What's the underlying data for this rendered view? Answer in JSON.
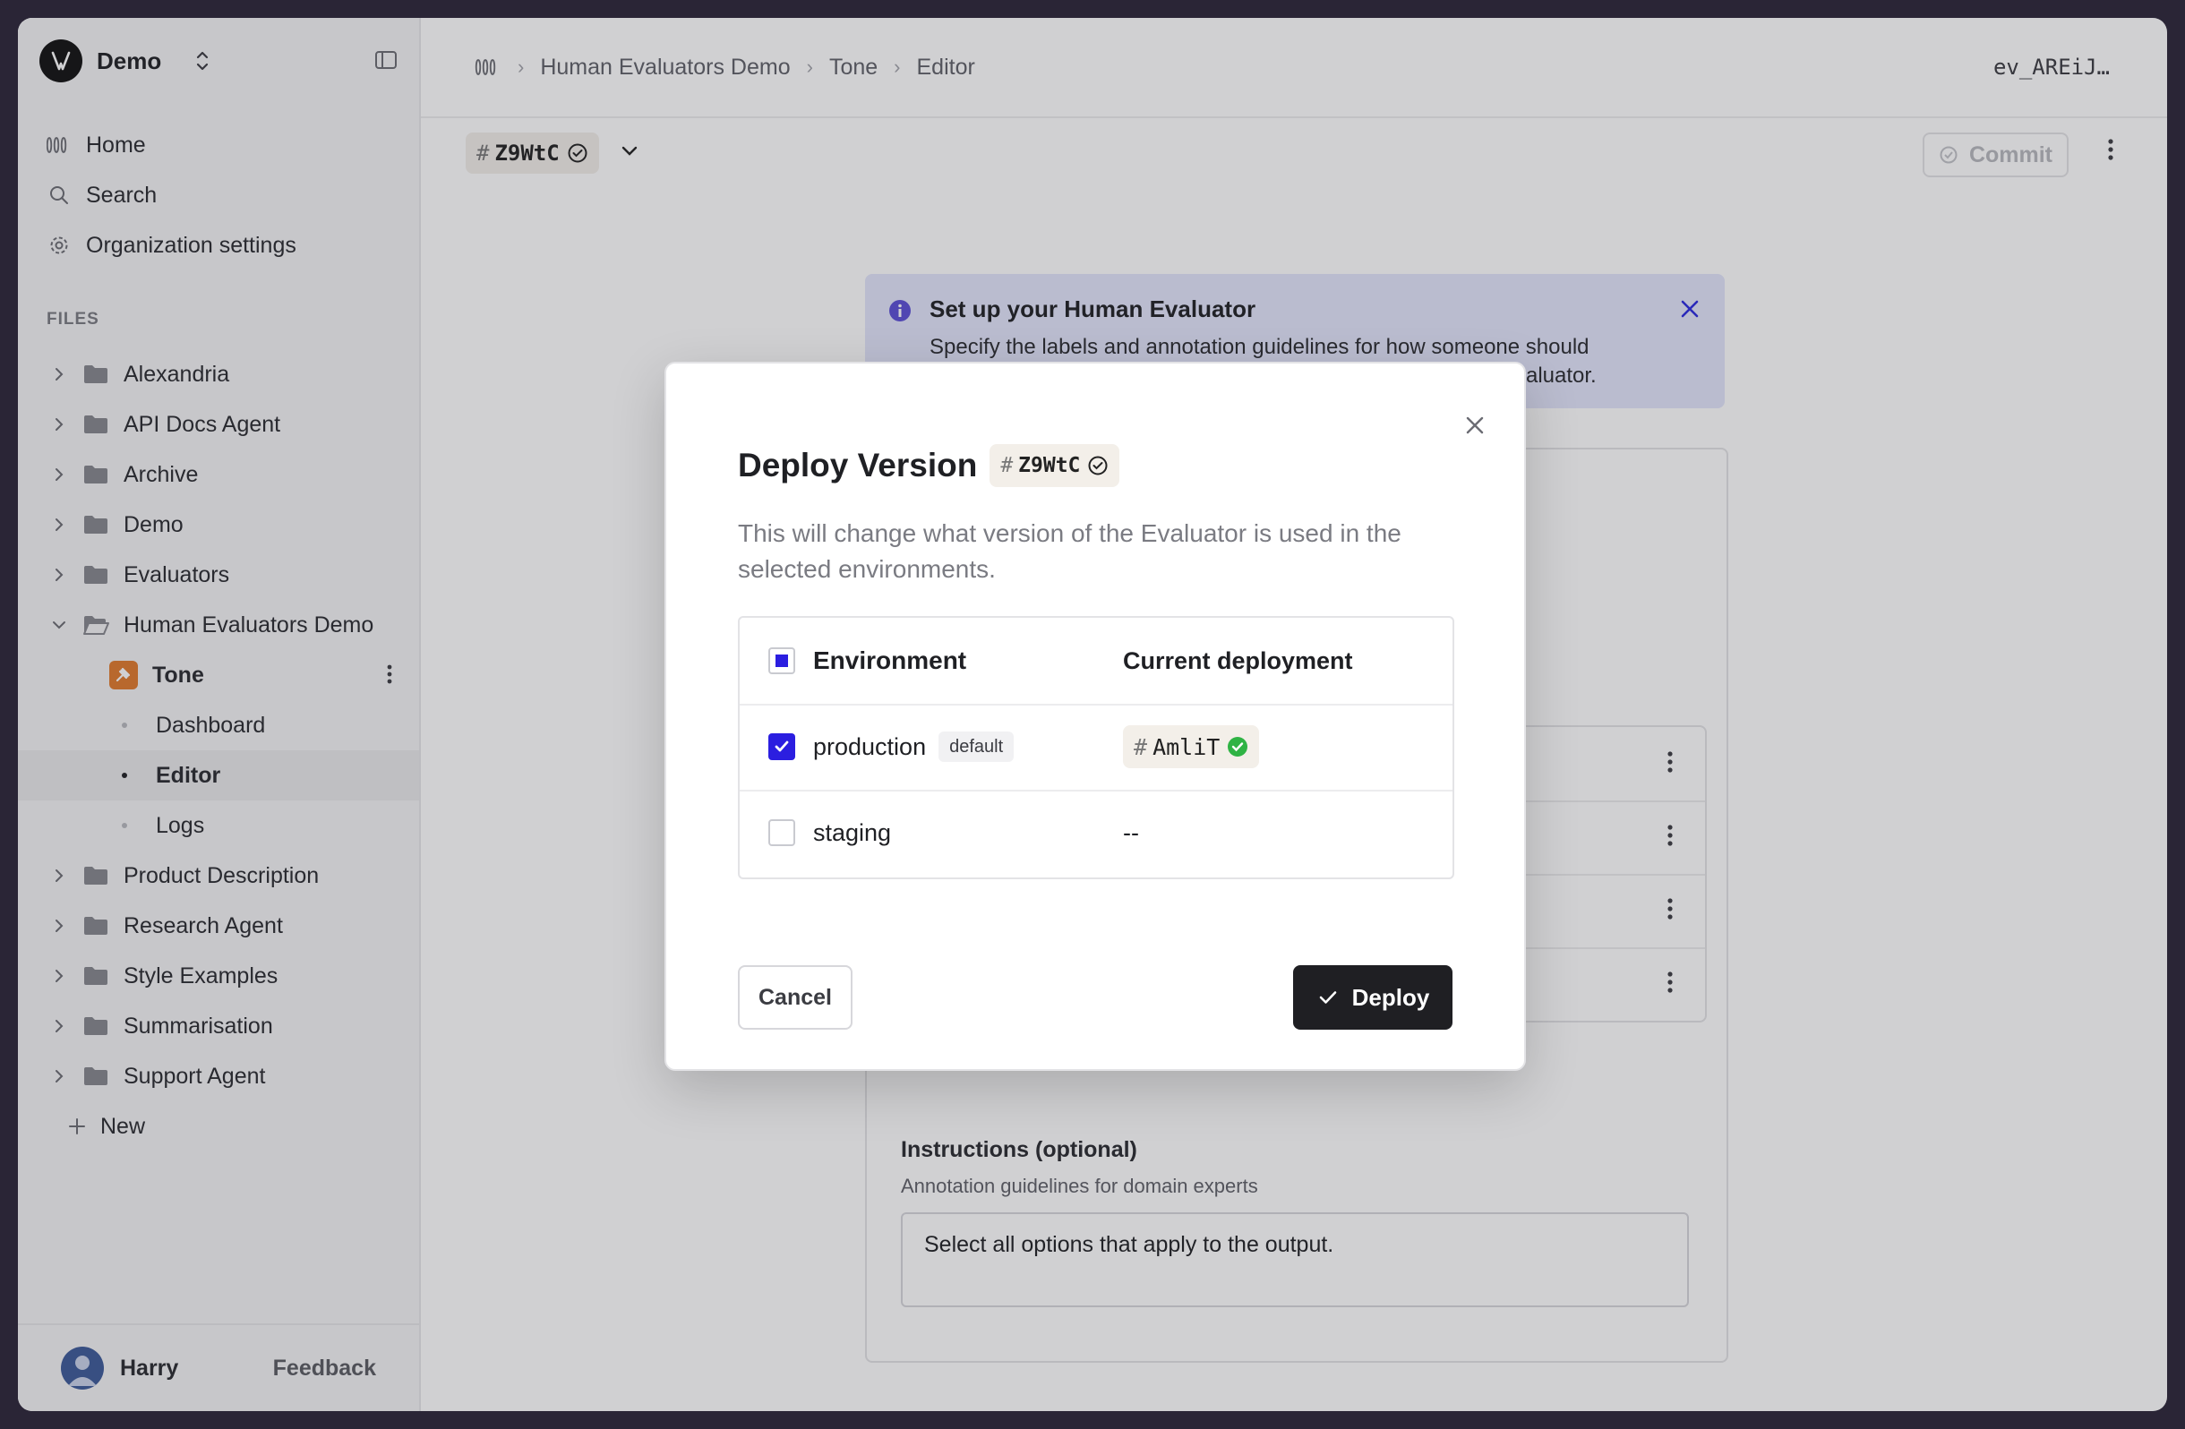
{
  "workspace": {
    "name": "Demo"
  },
  "nav": {
    "home": "Home",
    "search": "Search",
    "org_settings": "Organization settings"
  },
  "files": {
    "label": "FILES",
    "folders": [
      "Alexandria",
      "API Docs Agent",
      "Archive",
      "Demo",
      "Evaluators",
      "Human Evaluators Demo",
      "Product Description",
      "Research Agent",
      "Style Examples",
      "Summarisation",
      "Support Agent"
    ],
    "tone": "Tone",
    "tone_children": [
      "Dashboard",
      "Editor",
      "Logs"
    ],
    "new_label": "New"
  },
  "footer": {
    "user": "Harry",
    "feedback": "Feedback"
  },
  "topbar": {
    "breadcrumbs": [
      "Human Evaluators Demo",
      "Tone",
      "Editor"
    ],
    "file_id": "ev_AREiJ…"
  },
  "version": {
    "hash": "#",
    "id": "Z9WtC"
  },
  "commit_label": "Commit",
  "banner": {
    "title": "Set up your Human Evaluator",
    "text": "Specify the labels and annotation guidelines for how someone should",
    "text_tail": "valuator."
  },
  "instructions": {
    "title": "Instructions (optional)",
    "subtitle": "Annotation guidelines for domain experts",
    "value": "Select all options that apply to the output."
  },
  "modal": {
    "title": "Deploy Version",
    "version_id": "Z9WtC",
    "description": "This will change what version of the Evaluator is used in the selected environments.",
    "table": {
      "header_env": "Environment",
      "header_deploy": "Current deployment",
      "rows": [
        {
          "name": "production",
          "badge": "default",
          "deployment": "AmliT",
          "checked": true
        },
        {
          "name": "staging",
          "badge": "",
          "deployment": "--",
          "checked": false
        }
      ]
    },
    "cancel": "Cancel",
    "deploy": "Deploy"
  },
  "colors": {
    "accent": "#2b1ee0",
    "deploy_button": "#1f1f23",
    "banner_bg": "#e3e6fc",
    "tone_icon": "#e07a2c",
    "status_green": "#2fb344"
  }
}
